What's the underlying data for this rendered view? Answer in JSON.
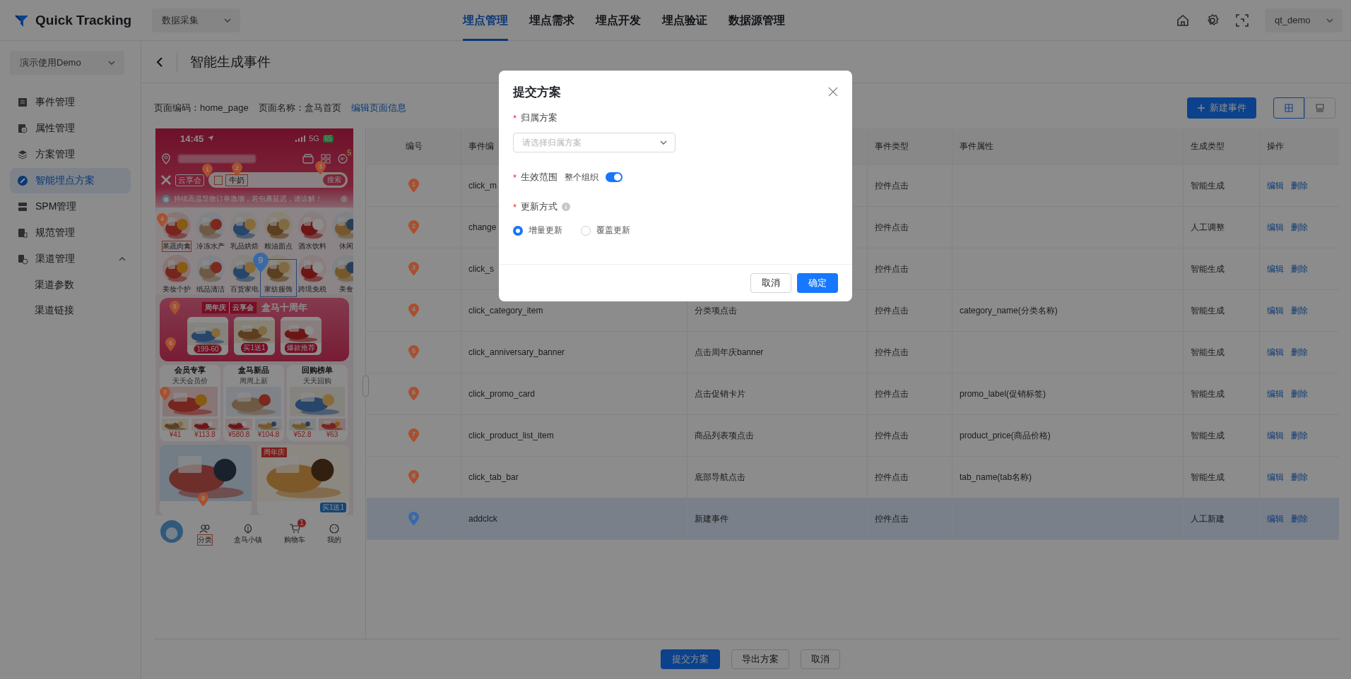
{
  "header": {
    "logo": "Quick Tracking",
    "product_select": "数据采集",
    "nav": [
      {
        "label": "埋点管理",
        "selected": true
      },
      {
        "label": "埋点需求",
        "selected": false
      },
      {
        "label": "埋点开发",
        "selected": false
      },
      {
        "label": "埋点验证",
        "selected": false
      },
      {
        "label": "数据源管理",
        "selected": false
      }
    ],
    "user": "qt_demo"
  },
  "sidebar": {
    "project": "演示使用Demo",
    "items": [
      {
        "label": "事件管理",
        "selected": false
      },
      {
        "label": "属性管理",
        "selected": false
      },
      {
        "label": "方案管理",
        "selected": false
      },
      {
        "label": "智能埋点方案",
        "selected": true
      },
      {
        "label": "SPM管理",
        "selected": false
      },
      {
        "label": "规范管理",
        "selected": false
      },
      {
        "label": "渠道管理",
        "selected": false,
        "expanded": true,
        "children": [
          {
            "label": "渠道参数",
            "selected": false
          },
          {
            "label": "渠道链接",
            "selected": false
          }
        ]
      }
    ]
  },
  "page": {
    "title": "智能生成事件",
    "info": [
      {
        "label": "页面编码：",
        "value": "home_page"
      },
      {
        "label": "页面名称：",
        "value": "盒马首页"
      }
    ],
    "edit_link": "编辑页面信息",
    "new_event_button": "新建事件",
    "view_modes": [
      {
        "kind": "table",
        "selected": true
      },
      {
        "kind": "card",
        "selected": false
      }
    ]
  },
  "phone": {
    "time": "14:45",
    "network": "5G",
    "battery": "65",
    "message_badge": "5",
    "club_logo": "云享会",
    "search_text": "牛奶",
    "search_button": "搜索",
    "notice": "持续高温导致订单激增，若包裹延迟，请谅解！",
    "categories": [
      "果蔬肉禽",
      "冷冻水产",
      "乳品烘焙",
      "粮油面点",
      "酒水饮料",
      "休闲",
      "美妆个护",
      "纸品清洁",
      "百货家电",
      "家纺服饰",
      "跨境免税",
      "美食"
    ],
    "banner": {
      "tag": "周年庆",
      "club": "云享会",
      "title": "盒马十周年",
      "cards": [
        "199-60",
        "买1送1",
        "爆款推荐"
      ]
    },
    "sections": [
      {
        "title": "会员专享",
        "tag": "天天会员价",
        "prices": [
          "¥41",
          "¥113.8"
        ]
      },
      {
        "title": "盒马新品",
        "tag": "周周上新",
        "prices": [
          "¥580.8",
          "¥104.8"
        ]
      },
      {
        "title": "回购榜单",
        "tag": "天天回购",
        "prices": [
          "¥52.8",
          "¥63"
        ]
      }
    ],
    "promo": {
      "tag": "周年庆",
      "offer": "买1送1"
    },
    "tabs": [
      {
        "kind": "avatar"
      },
      {
        "kind": "tab",
        "label": "分类"
      },
      {
        "kind": "tab",
        "label": "盒马小镇"
      },
      {
        "kind": "tab",
        "label": "购物车",
        "badge": "1"
      },
      {
        "kind": "tab",
        "label": "我的"
      }
    ],
    "markers": [
      {
        "number": "1",
        "color": "#a8502f"
      },
      {
        "number": "2",
        "color": "#a8502f"
      },
      {
        "number": "3",
        "color": "#a8502f"
      },
      {
        "number": "4",
        "color": "#a8502f"
      },
      {
        "number": "5",
        "color": "#a8502f"
      },
      {
        "number": "6",
        "color": "#a8502f"
      },
      {
        "number": "7",
        "color": "#a8502f"
      },
      {
        "number": "8",
        "color": "#a8502f"
      },
      {
        "number": "9",
        "color": "#3a69a8"
      }
    ]
  },
  "table": {
    "columns": [
      {
        "label": "编号"
      },
      {
        "label": "事件编"
      },
      {},
      {
        "label": "事件类型"
      },
      {
        "label": "事件属性"
      },
      {
        "label": "生成类型"
      },
      {
        "label": "操作"
      }
    ],
    "rows": [
      {
        "marker": "1",
        "color": "#a8502f",
        "code": "click_m",
        "type": "控件点击",
        "generation": "智能生成",
        "actions": [
          "编辑",
          "删除"
        ],
        "selected": false
      },
      {
        "marker": "2",
        "color": "#a8502f",
        "code": "change",
        "type": "控件点击",
        "generation": "人工调整",
        "actions": [
          "编辑",
          "删除"
        ],
        "selected": false
      },
      {
        "marker": "3",
        "color": "#a8502f",
        "code": "click_s",
        "type": "控件点击",
        "generation": "智能生成",
        "actions": [
          "编辑",
          "删除"
        ],
        "selected": false
      },
      {
        "marker": "4",
        "color": "#a8502f",
        "code": "click_category_item",
        "name": "分类项点击",
        "type": "控件点击",
        "attribute": "category_name(分类名称)",
        "generation": "智能生成",
        "actions": [
          "编辑",
          "删除"
        ],
        "selected": false
      },
      {
        "marker": "5",
        "color": "#a8502f",
        "code": "click_anniversary_banner",
        "name": "点击周年庆banner",
        "type": "控件点击",
        "generation": "智能生成",
        "actions": [
          "编辑",
          "删除"
        ],
        "selected": false
      },
      {
        "marker": "6",
        "color": "#a8502f",
        "code": "click_promo_card",
        "name": "点击促销卡片",
        "type": "控件点击",
        "attribute": "promo_label(促销标签)",
        "generation": "智能生成",
        "actions": [
          "编辑",
          "删除"
        ],
        "selected": false
      },
      {
        "marker": "7",
        "color": "#a8502f",
        "code": "click_product_list_item",
        "name": "商品列表项点击",
        "type": "控件点击",
        "attribute": "product_price(商品价格)",
        "generation": "智能生成",
        "actions": [
          "编辑",
          "删除"
        ],
        "selected": false
      },
      {
        "marker": "8",
        "color": "#a8502f",
        "code": "click_tab_bar",
        "name": "底部导航点击",
        "type": "控件点击",
        "attribute": "tab_name(tab名称)",
        "generation": "智能生成",
        "actions": [
          "编辑",
          "删除"
        ],
        "selected": false
      },
      {
        "marker": "9",
        "color": "#3a69a8",
        "code": "addclck",
        "name": "新建事件",
        "type": "控件点击",
        "generation": "人工新建",
        "actions": [
          "编辑",
          "删除"
        ],
        "selected": true
      }
    ]
  },
  "footer": {
    "buttons": [
      {
        "label": "提交方案",
        "kind": "primary"
      },
      {
        "label": "导出方案",
        "kind": "default"
      },
      {
        "label": "取消",
        "kind": "default"
      }
    ]
  },
  "dialog": {
    "title": "提交方案",
    "fields": [
      {
        "kind": "select",
        "label": "归属方案",
        "required_mark": "*",
        "placeholder": "请选择归属方案"
      },
      {
        "kind": "switch",
        "label": "生效范围",
        "required_mark": "*",
        "text": "整个组织",
        "on": true
      },
      {
        "kind": "radio",
        "label": "更新方式",
        "required_mark": "*",
        "info": true,
        "options": [
          {
            "label": "增量更新",
            "selected": true
          },
          {
            "label": "覆盖更新",
            "selected": false
          }
        ]
      }
    ],
    "buttons": [
      {
        "label": "取消",
        "kind": "default"
      },
      {
        "label": "确定",
        "kind": "primary"
      }
    ]
  }
}
